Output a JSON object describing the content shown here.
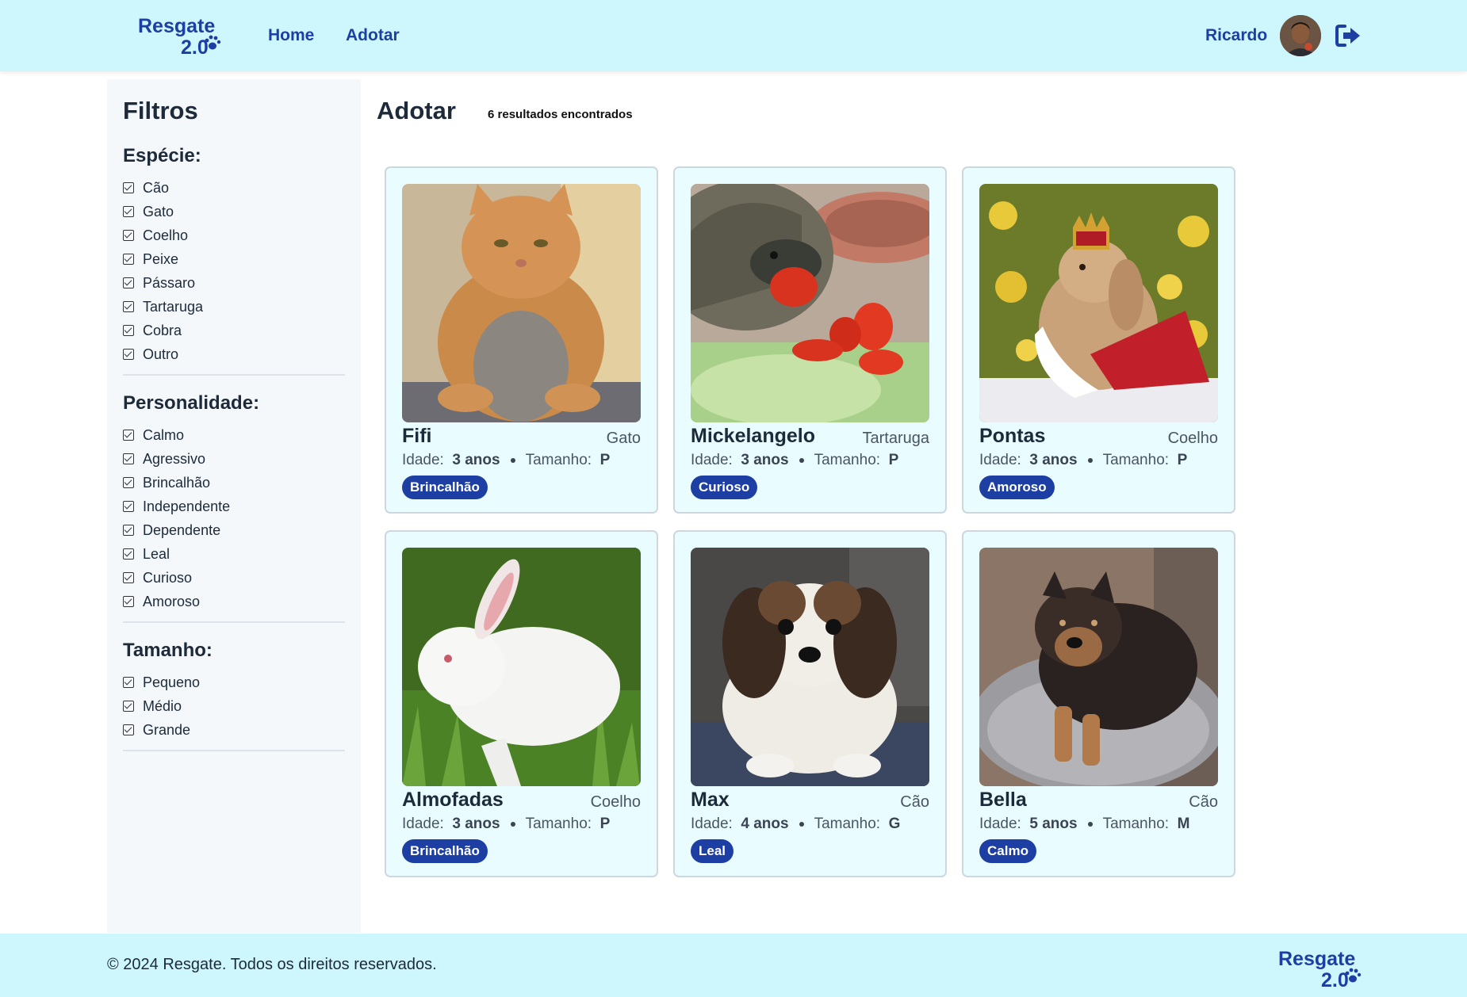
{
  "header": {
    "logo_text": "Resgate",
    "logo_version": "2.0",
    "nav": [
      {
        "label": "Home"
      },
      {
        "label": "Adotar"
      }
    ],
    "user_name": "Ricardo"
  },
  "sidebar": {
    "title": "Filtros",
    "groups": [
      {
        "title": "Espécie:",
        "options": [
          "Cão",
          "Gato",
          "Coelho",
          "Peixe",
          "Pássaro",
          "Tartaruga",
          "Cobra",
          "Outro"
        ]
      },
      {
        "title": "Personalidade:",
        "options": [
          "Calmo",
          "Agressivo",
          "Brincalhão",
          "Independente",
          "Dependente",
          "Leal",
          "Curioso",
          "Amoroso"
        ]
      },
      {
        "title": "Tamanho:",
        "options": [
          "Pequeno",
          "Médio",
          "Grande"
        ]
      }
    ]
  },
  "main": {
    "title": "Adotar",
    "results": "6 resultados encontrados",
    "age_label": "Idade:",
    "size_label": "Tamanho:",
    "pets": [
      {
        "name": "Fifi",
        "species": "Gato",
        "age": "3 anos",
        "size": "P",
        "trait": "Brincalhão"
      },
      {
        "name": "Mickelangelo",
        "species": "Tartaruga",
        "age": "3 anos",
        "size": "P",
        "trait": "Curioso"
      },
      {
        "name": "Pontas",
        "species": "Coelho",
        "age": "3 anos",
        "size": "P",
        "trait": "Amoroso"
      },
      {
        "name": "Almofadas",
        "species": "Coelho",
        "age": "3 anos",
        "size": "P",
        "trait": "Brincalhão"
      },
      {
        "name": "Max",
        "species": "Cão",
        "age": "4 anos",
        "size": "G",
        "trait": "Leal"
      },
      {
        "name": "Bella",
        "species": "Cão",
        "age": "5 anos",
        "size": "M",
        "trait": "Calmo"
      }
    ]
  },
  "footer": {
    "copyright": "© 2024 Resgate. Todos os direitos reservados."
  },
  "colors": {
    "header_bg": "#cdf7fc",
    "brand_blue": "#1d3ea3",
    "card_bg": "#e9fcff",
    "sidebar_bg": "#f5f8fb"
  }
}
